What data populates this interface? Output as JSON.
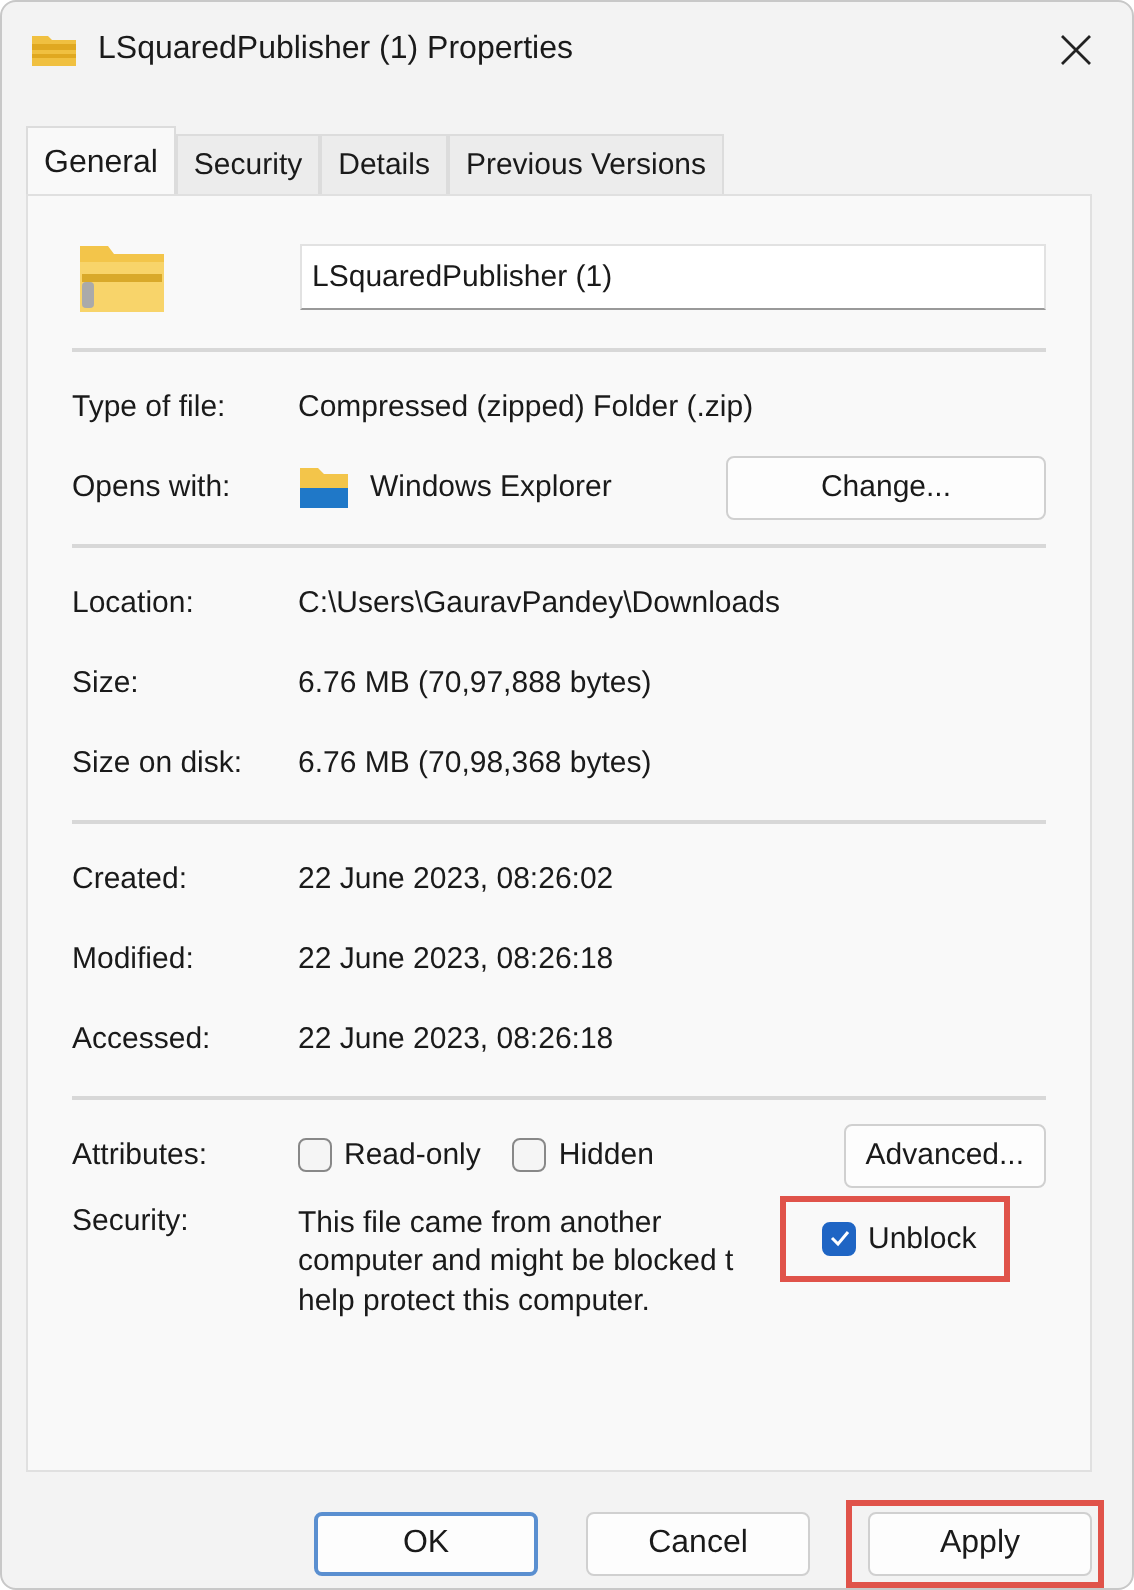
{
  "window": {
    "title": "LSquaredPublisher (1) Properties"
  },
  "tabs": [
    {
      "label": "General",
      "selected": true
    },
    {
      "label": "Security",
      "selected": false
    },
    {
      "label": "Details",
      "selected": false
    },
    {
      "label": "Previous Versions",
      "selected": false
    }
  ],
  "name_field": {
    "value": "LSquaredPublisher (1)"
  },
  "type_section": [
    {
      "label": "Type of file:",
      "value": "Compressed (zipped) Folder (.zip)"
    },
    {
      "label": "Opens with:",
      "value": "Windows Explorer",
      "button": "Change..."
    }
  ],
  "location_section": [
    {
      "label": "Location:",
      "value": "C:\\Users\\GauravPandey\\Downloads"
    },
    {
      "label": "Size:",
      "value": "6.76 MB (70,97,888 bytes)"
    },
    {
      "label": "Size on disk:",
      "value": "6.76 MB (70,98,368 bytes)"
    }
  ],
  "date_section": [
    {
      "label": "Created:",
      "value": "22 June 2023, 08:26:02"
    },
    {
      "label": "Modified:",
      "value": "22 June 2023, 08:26:18"
    },
    {
      "label": "Accessed:",
      "value": "22 June 2023, 08:26:18"
    }
  ],
  "attributes": {
    "label": "Attributes:",
    "checkboxes": [
      {
        "label": "Read-only",
        "checked": false
      },
      {
        "label": "Hidden",
        "checked": false
      }
    ],
    "button": "Advanced..."
  },
  "security": {
    "label": "Security:",
    "text": "This file came from another\ncomputer and might be blocked t\nhelp protect this computer.",
    "unblock": {
      "label": "Unblock",
      "checked": true,
      "highlighted": true
    }
  },
  "buttons": [
    {
      "label": "OK",
      "default": true,
      "highlighted": false
    },
    {
      "label": "Cancel",
      "default": false,
      "highlighted": false
    },
    {
      "label": "Apply",
      "default": false,
      "highlighted": true
    }
  ]
}
